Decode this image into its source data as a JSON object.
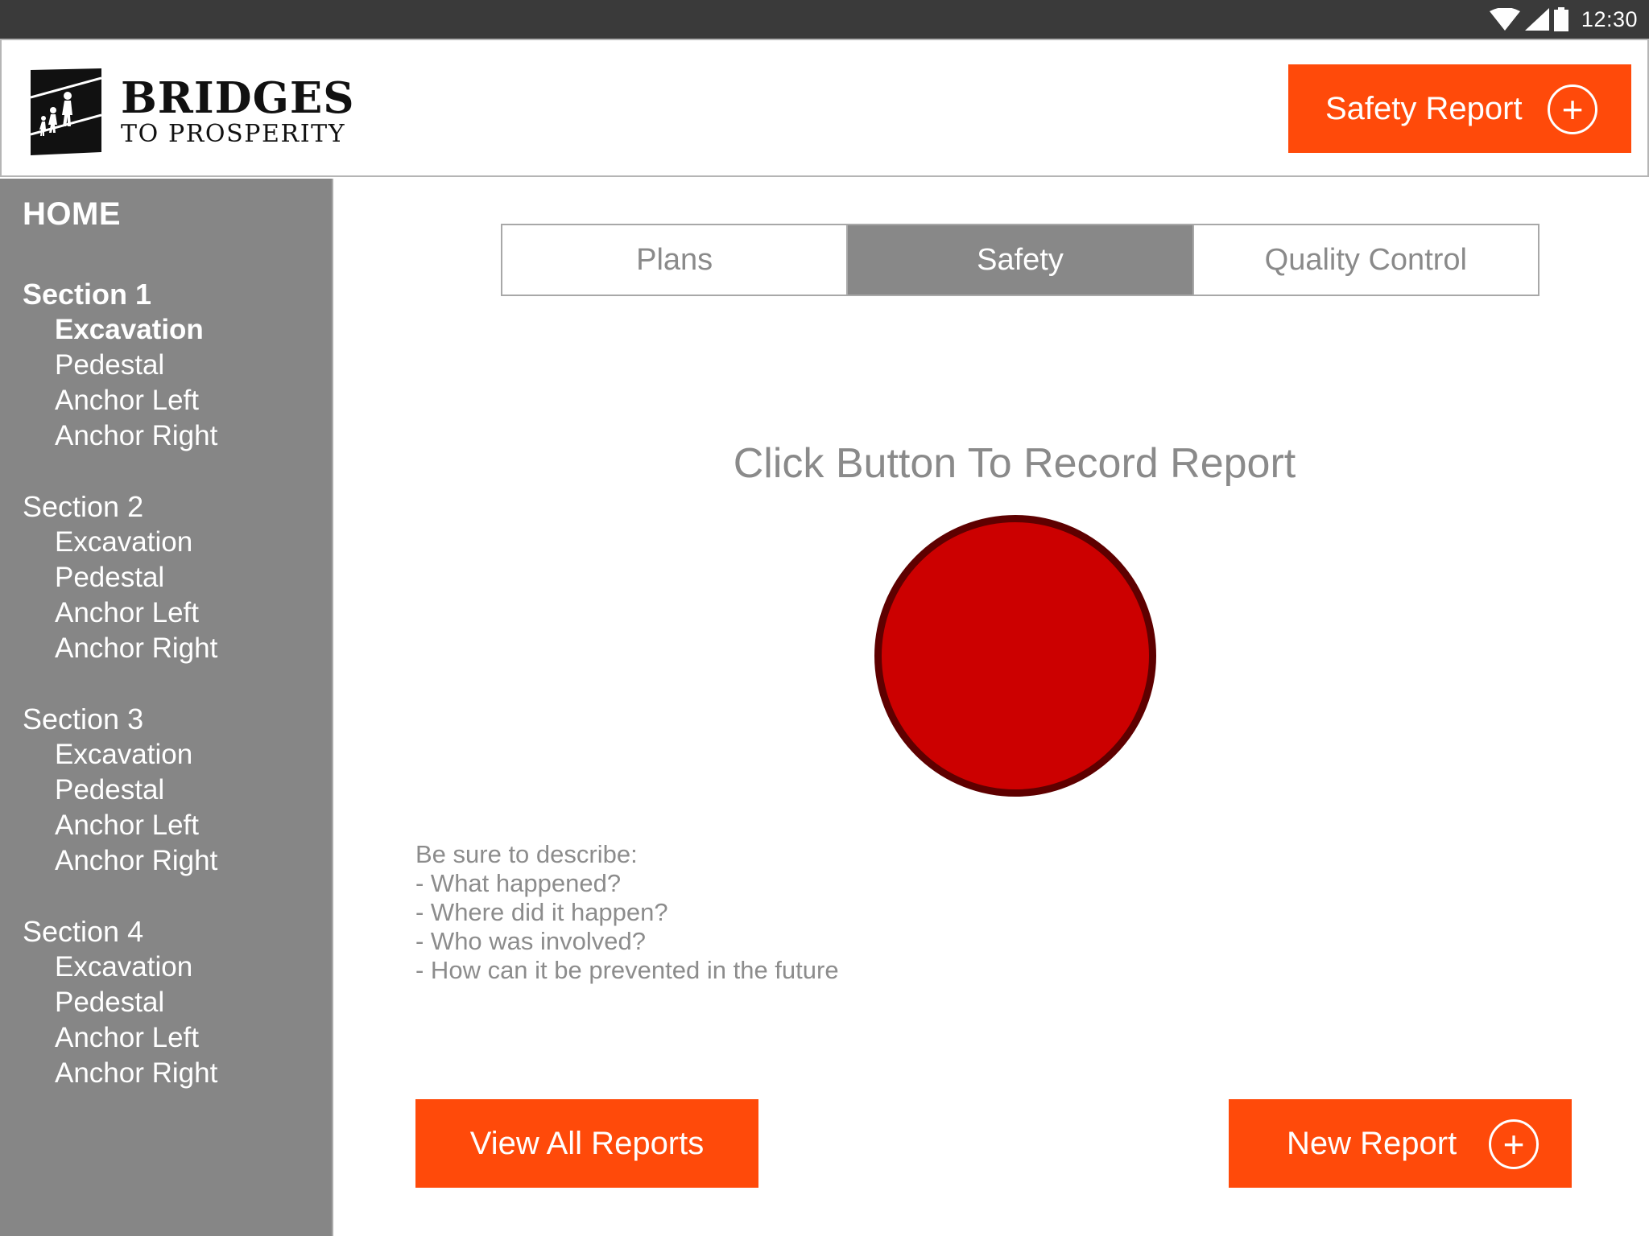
{
  "status_bar": {
    "time": "12:30"
  },
  "logo": {
    "line1": "BRIDGES",
    "line2": "TO PROSPERITY"
  },
  "header": {
    "safety_report_label": "Safety Report",
    "plus_symbol": "+"
  },
  "sidebar": {
    "home_label": "HOME",
    "sections": [
      {
        "title": "Section 1",
        "items": [
          "Excavation",
          "Pedestal",
          "Anchor Left",
          "Anchor Right"
        ]
      },
      {
        "title": "Section 2",
        "items": [
          "Excavation",
          "Pedestal",
          "Anchor Left",
          "Anchor Right"
        ]
      },
      {
        "title": "Section 3",
        "items": [
          "Excavation",
          "Pedestal",
          "Anchor Left",
          "Anchor Right"
        ]
      },
      {
        "title": "Section 4",
        "items": [
          "Excavation",
          "Pedestal",
          "Anchor Left",
          "Anchor Right"
        ]
      }
    ]
  },
  "tabs": [
    {
      "label": "Plans"
    },
    {
      "label": "Safety"
    },
    {
      "label": "Quality Control"
    }
  ],
  "main": {
    "record_title": "Click Button To Record Report",
    "instructions": [
      "Be sure to describe:",
      "- What happened?",
      "- Where did it happen?",
      "- Who was involved?",
      "- How can it be prevented in the future"
    ],
    "view_all_label": "View All Reports",
    "new_report_label": "New Report",
    "plus_symbol": "+"
  },
  "colors": {
    "accent": "#ff4a0a",
    "sidebar_bg": "#868686",
    "tab_active_bg": "#888888",
    "record_button_fill": "#cc0000",
    "record_button_border": "#5e0000",
    "status_bar_bg": "#3a3a3a"
  },
  "icons": [
    "wifi-icon",
    "signal-icon",
    "battery-icon",
    "plus-circle-icon",
    "bridge-logo-icon"
  ]
}
